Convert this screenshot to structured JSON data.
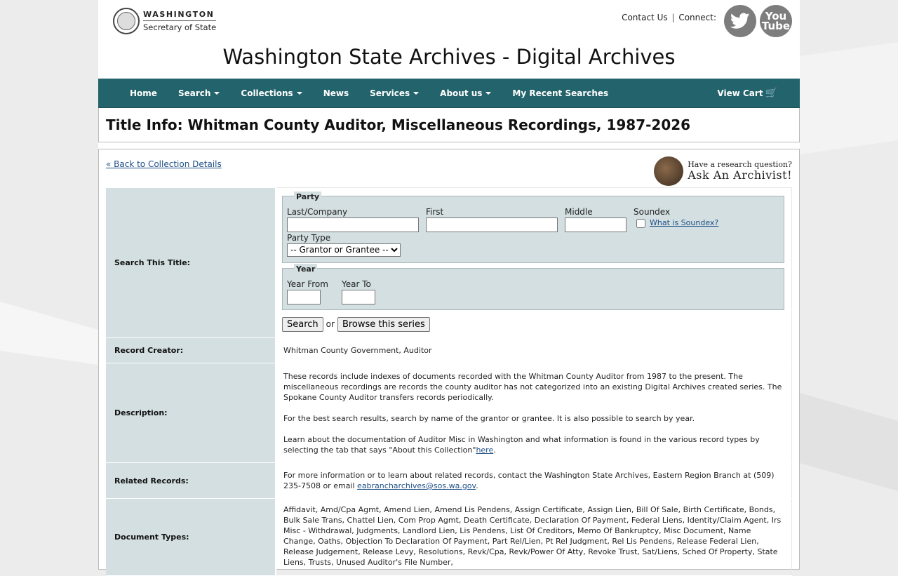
{
  "header": {
    "logo_line1": "WASHINGTON",
    "logo_line2": "Secretary of State",
    "contact_label": "Contact Us",
    "separator": "|",
    "connect_label": "Connect:",
    "youtube_label_1": "You",
    "youtube_label_2": "Tube",
    "site_title": "Washington State Archives - Digital Archives"
  },
  "nav": {
    "home": "Home",
    "search": "Search",
    "collections": "Collections",
    "news": "News",
    "services": "Services",
    "about": "About us",
    "recent": "My Recent Searches",
    "cart": "View Cart"
  },
  "page_title": "Title Info: Whitman County Auditor, Miscellaneous Recordings, 1987-2026",
  "back_link": "« Back to Collection Details",
  "archivist": {
    "line1": "Have a research question?",
    "line2": "Ask An Archivist!"
  },
  "search_form": {
    "label": "Search This Title:",
    "party_legend": "Party",
    "last_company": "Last/Company",
    "first": "First",
    "middle": "Middle",
    "soundex": "Soundex",
    "soundex_link": "What is Soundex?",
    "party_type": "Party Type",
    "party_type_selected": "-- Grantor or Grantee --",
    "year_legend": "Year",
    "year_from": "Year From",
    "year_to": "Year To",
    "search_button": "Search",
    "or": "or",
    "browse_button": "Browse this series"
  },
  "rows": {
    "creator_label": "Record Creator:",
    "creator_value": "Whitman County Government, Auditor",
    "description_label": "Description:",
    "description_p1": "These records include indexes of documents recorded with the Whitman County Auditor from 1987 to the present. The miscellaneous recordings are records the county auditor has not categorized into an existing Digital Archives created series. The Spokane County Auditor transfers records periodically.",
    "description_p2": "For the best search results, search by name of the grantor or grantee. It is also possible to search by year.",
    "description_p3": "Learn about the documentation of Auditor Misc in Washington and what information is found in the various record types by selecting the tab that says \"About this Collection\"",
    "description_p3_link": "here",
    "description_p3_end": ".",
    "related_label": "Related Records:",
    "related_value": "For more information or to learn about related records, contact the Washington State Archives, Eastern Region Branch at (509) 235-7508 or email ",
    "related_email": "eabranchar­chives@sos.wa.gov",
    "related_end": ".",
    "doctypes_label": "Document Types:",
    "doctypes_value": "Affidavit, Amd/Cpa Agmt, Amend Lien, Amend Lis Pendens, Assign Certificate, Assign Lien, Bill Of Sale, Birth Certificate, Bonds, Bulk Sale Trans, Chattel Lien, Com Prop Agmt, Death Certificate, Declaration Of Payment, Federal Liens, Identity/Claim Agent, Irs Misc - Withdrawal, Judgments, Landlord Lien, Lis Pendens, List Of Creditors, Memo Of Bankruptcy, Misc Document, Name Change, Oaths, Objection To Declaration Of Payment, Part Rel/Lien, Pt Rel Judgment, Rel Lis Pendens, Release Federal Lien, Release Judgement, Release Levy, Resolutions, Revk/Cpa, Revk/Power Of Atty, Revoke Trust, Sat/Liens, Sched Of Property, State Liens, Trusts, Unused Auditor's File Number,"
  }
}
